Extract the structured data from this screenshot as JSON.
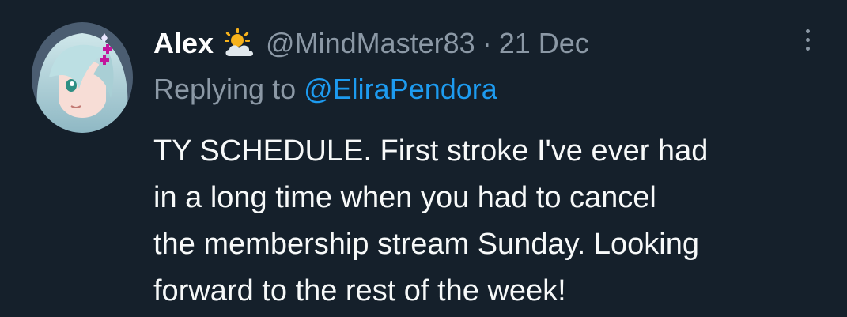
{
  "tweet": {
    "display_name": "Alex",
    "name_emoji": "sun-behind-cloud",
    "handle": "@MindMaster83",
    "separator": "·",
    "date": "21 Dec",
    "reply_prefix": "Replying to",
    "reply_to": "@EliraPendora",
    "body_lines": [
      "TY SCHEDULE. First stroke I've ever had",
      "in a long time when you had to cancel",
      "the membership stream Sunday. Looking",
      "forward to the rest of the week!"
    ]
  },
  "icons": {
    "more": "more-vertical-icon",
    "weather": "sun-behind-cloud-icon"
  },
  "colors": {
    "background": "#15202b",
    "text_primary": "#f7f9f9",
    "text_secondary": "#8b98a5",
    "link": "#1d9bf0"
  }
}
